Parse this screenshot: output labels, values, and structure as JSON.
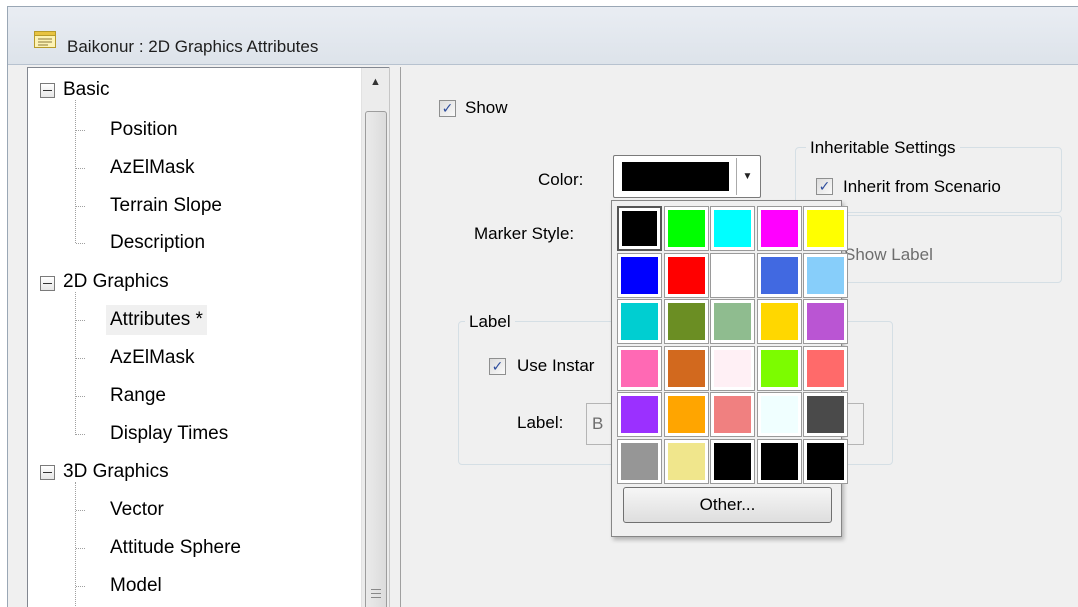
{
  "window": {
    "title": "Baikonur : 2D Graphics Attributes"
  },
  "tree": {
    "groups": [
      {
        "label": "Basic",
        "children": [
          "Position",
          "AzElMask",
          "Terrain Slope",
          "Description"
        ]
      },
      {
        "label": "2D Graphics",
        "children": [
          "Attributes *",
          "AzElMask",
          "Range",
          "Display Times"
        ]
      },
      {
        "label": "3D Graphics",
        "children": [
          "Vector",
          "Attitude Sphere",
          "Model"
        ]
      }
    ],
    "selected": "Attributes *"
  },
  "form": {
    "show_label": "Show",
    "show_checked": true,
    "color_label": "Color:",
    "color_value": "#000000",
    "marker_style_label": "Marker Style:",
    "inheritable_title": "Inheritable Settings",
    "inherit_label": "Inherit from Scenario",
    "inherit_checked": true,
    "show_label_text": "Show Label",
    "label_group_title": "Label",
    "use_instance_label": "Use Instar",
    "use_instance_checked": true,
    "label_field_label": "Label:",
    "label_field_value": "B"
  },
  "color_popup": {
    "colors": [
      [
        "#000000",
        "#00ff00",
        "#00ffff",
        "#ff00ff",
        "#ffff00"
      ],
      [
        "#0000ff",
        "#ff0000",
        "#ffffff",
        "#4169e1",
        "#87cefa"
      ],
      [
        "#00ced1",
        "#6b8e23",
        "#8fbc8f",
        "#ffd700",
        "#ba55d3"
      ],
      [
        "#ff69b4",
        "#d2691e",
        "#fff0f5",
        "#7cfc00",
        "#ff6a6a"
      ],
      [
        "#9b30ff",
        "#ffa500",
        "#f08080",
        "#f0ffff",
        "#4a4a4a"
      ],
      [
        "#969696",
        "#f0e68c",
        "#000000",
        "#000000",
        "#000000"
      ]
    ],
    "selected_index": 0,
    "other_label": "Other..."
  }
}
